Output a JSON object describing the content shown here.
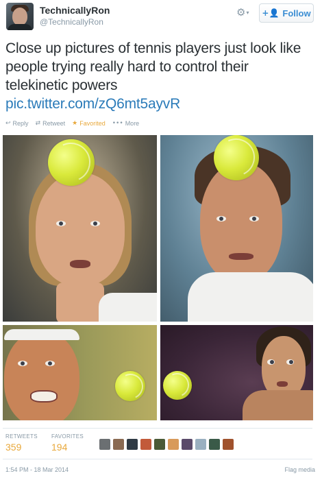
{
  "header": {
    "display_name": "TechnicallyRon",
    "handle": "@TechnicallyRon",
    "gear_icon": "⚙",
    "gear_caret": "▾",
    "follow_icon": "+👤",
    "follow_label": "Follow"
  },
  "tweet": {
    "text": "Close up pictures of tennis players just look like people trying really hard to control their telekinetic powers",
    "link": "pic.twitter.com/zQ6mt5ayvR"
  },
  "actions": {
    "reply_icon": "↩",
    "reply_label": "Reply",
    "retweet_icon": "⇄",
    "retweet_label": "Retweet",
    "favorite_icon": "★",
    "favorite_label": "Favorited",
    "more_icon": "•••",
    "more_label": "More"
  },
  "stats": {
    "retweets_label": "RETWEETS",
    "retweets_value": "359",
    "favorites_label": "FAVORITES",
    "favorites_value": "194"
  },
  "favoriter_avatars": [
    "#6b6f72",
    "#8a6a52",
    "#2f3a44",
    "#c25a3a",
    "#4a5a36",
    "#d89a5a",
    "#5a4a6a",
    "#9ab0c0",
    "#3a5a48",
    "#a0522d"
  ],
  "footer": {
    "timestamp": "1:54 PM - 18 Mar 2014",
    "flag_label": "Flag media"
  },
  "colors": {
    "link": "#2b7bb9",
    "favorite": "#e8a83b",
    "muted": "#8899a6",
    "follow": "#3a8dd3"
  }
}
